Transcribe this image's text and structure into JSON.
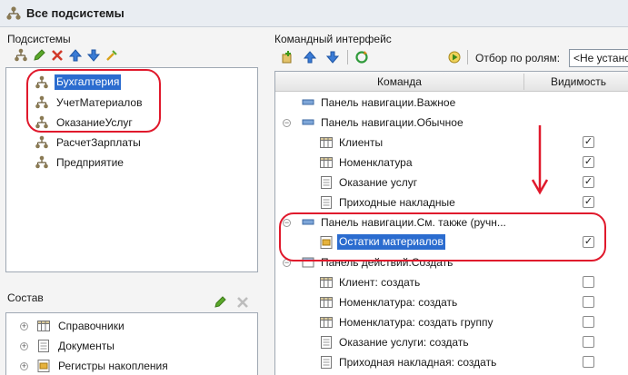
{
  "window": {
    "title": "Все подсистемы"
  },
  "subsystems": {
    "label": "Подсистемы",
    "items": [
      {
        "label": "Бухгалтерия",
        "selected": true
      },
      {
        "label": "УчетМатериалов",
        "selected": false
      },
      {
        "label": "ОказаниеУслуг",
        "selected": false
      },
      {
        "label": "РасчетЗарплаты",
        "selected": false
      },
      {
        "label": "Предприятие",
        "selected": false
      }
    ]
  },
  "composition": {
    "label": "Состав",
    "items": [
      {
        "label": "Справочники",
        "icon": "catalog-icon"
      },
      {
        "label": "Документы",
        "icon": "document-icon"
      },
      {
        "label": "Регистры накопления",
        "icon": "register-icon"
      }
    ]
  },
  "command_interface": {
    "label": "Командный интерфейс",
    "filter_label": "Отбор по ролям:",
    "filter_value": "<Не устано",
    "columns": {
      "command": "Команда",
      "visibility": "Видимость"
    },
    "rows": [
      {
        "label": "Панель навигации.Важное",
        "type": "group",
        "expander": "",
        "has_checkbox": false,
        "checked": false,
        "icon": "panel-icon"
      },
      {
        "label": "Панель навигации.Обычное",
        "type": "group",
        "expander": "−",
        "has_checkbox": false,
        "checked": false,
        "icon": "panel-icon"
      },
      {
        "label": "Клиенты",
        "type": "item",
        "expander": "",
        "has_checkbox": true,
        "checked": true,
        "icon": "catalog-icon"
      },
      {
        "label": "Номенклатура",
        "type": "item",
        "expander": "",
        "has_checkbox": true,
        "checked": true,
        "icon": "catalog-icon"
      },
      {
        "label": "Оказание услуг",
        "type": "item",
        "expander": "",
        "has_checkbox": true,
        "checked": true,
        "icon": "document-icon"
      },
      {
        "label": "Приходные накладные",
        "type": "item",
        "expander": "",
        "has_checkbox": true,
        "checked": true,
        "icon": "document-icon"
      },
      {
        "label": "Панель навигации.См. также (ручн...",
        "type": "group",
        "expander": "−",
        "has_checkbox": false,
        "checked": false,
        "icon": "panel-icon"
      },
      {
        "label": "Остатки материалов",
        "type": "item",
        "expander": "",
        "has_checkbox": true,
        "checked": true,
        "icon": "register-icon",
        "selected": true
      },
      {
        "label": "Панель действий.Создать",
        "type": "group",
        "expander": "−",
        "has_checkbox": false,
        "checked": false,
        "icon": "action-panel-icon"
      },
      {
        "label": "Клиент: создать",
        "type": "item",
        "expander": "",
        "has_checkbox": true,
        "checked": false,
        "icon": "catalog-icon"
      },
      {
        "label": "Номенклатура: создать",
        "type": "item",
        "expander": "",
        "has_checkbox": true,
        "checked": false,
        "icon": "catalog-icon"
      },
      {
        "label": "Номенклатура: создать группу",
        "type": "item",
        "expander": "",
        "has_checkbox": true,
        "checked": false,
        "icon": "catalog-icon"
      },
      {
        "label": "Оказание услуги: создать",
        "type": "item",
        "expander": "",
        "has_checkbox": true,
        "checked": false,
        "icon": "document-icon"
      },
      {
        "label": "Приходная накладная: создать",
        "type": "item",
        "expander": "",
        "has_checkbox": true,
        "checked": false,
        "icon": "document-icon"
      }
    ]
  },
  "colors": {
    "selection": "#2b6ccf",
    "annotation_red": "#e0192c",
    "subsystem_icon": "#8a7a54"
  }
}
